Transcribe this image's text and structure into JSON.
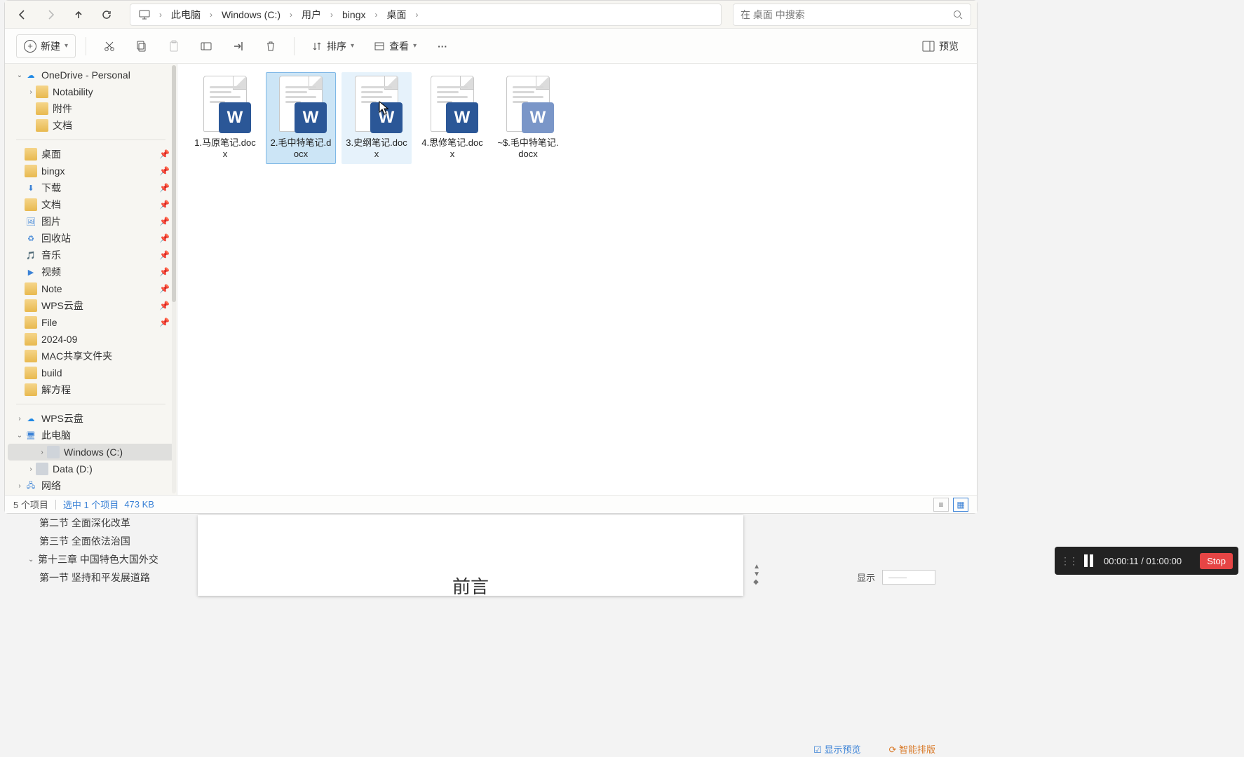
{
  "nav": {
    "monitorIcon": "monitor-icon"
  },
  "breadcrumb": [
    "此电脑",
    "Windows (C:)",
    "用户",
    "bingx",
    "桌面"
  ],
  "search": {
    "placeholder": "在 桌面 中搜索"
  },
  "toolbar": {
    "new": "新建",
    "sort": "排序",
    "view": "查看",
    "preview": "预览"
  },
  "sidebar": {
    "onedrive": "OneDrive - Personal",
    "onedrive_children": [
      "Notability",
      "附件",
      "文档"
    ],
    "pinned": [
      {
        "label": "桌面",
        "icon": "folder"
      },
      {
        "label": "bingx",
        "icon": "folder"
      },
      {
        "label": "下载",
        "icon": "download"
      },
      {
        "label": "文档",
        "icon": "folder"
      },
      {
        "label": "图片",
        "icon": "pictures"
      },
      {
        "label": "回收站",
        "icon": "recycle"
      },
      {
        "label": "音乐",
        "icon": "music"
      },
      {
        "label": "视频",
        "icon": "video"
      },
      {
        "label": "Note",
        "icon": "folder"
      },
      {
        "label": "WPS云盘",
        "icon": "folder"
      },
      {
        "label": "File",
        "icon": "folder"
      },
      {
        "label": "2024-09",
        "icon": "folder"
      },
      {
        "label": "MAC共享文件夹",
        "icon": "folder"
      },
      {
        "label": "build",
        "icon": "folder"
      },
      {
        "label": "解方程",
        "icon": "folder"
      }
    ],
    "wps": "WPS云盘",
    "thispc": "此电脑",
    "drives": [
      "Windows (C:)",
      "Data (D:)"
    ],
    "network": "网络"
  },
  "files": [
    {
      "name": "1.马原笔记.docx",
      "state": "normal"
    },
    {
      "name": "2.毛中特笔记.docx",
      "state": "selected"
    },
    {
      "name": "3.史纲笔记.docx",
      "state": "hover"
    },
    {
      "name": "4.思修笔记.docx",
      "state": "normal"
    },
    {
      "name": "~$.毛中特笔记.docx",
      "state": "dim"
    }
  ],
  "status": {
    "count": "5 个项目",
    "selection": "选中 1 个项目",
    "size": "473 KB"
  },
  "outline": {
    "items": [
      {
        "level": 1,
        "label": "第二节 全面深化改革"
      },
      {
        "level": 1,
        "label": "第三节 全面依法治国"
      },
      {
        "level": 0,
        "label": "第十三章 中国特色大国外交"
      },
      {
        "level": 1,
        "label": "第一节 坚持和平发展道路"
      }
    ],
    "show": "显示"
  },
  "docTitle": "前言",
  "bottomLinks": {
    "cloud": "显示预览",
    "smart": "智能排版"
  },
  "recorder": {
    "elapsed": "00:00:11",
    "total": "01:00:00",
    "stop": "Stop"
  }
}
